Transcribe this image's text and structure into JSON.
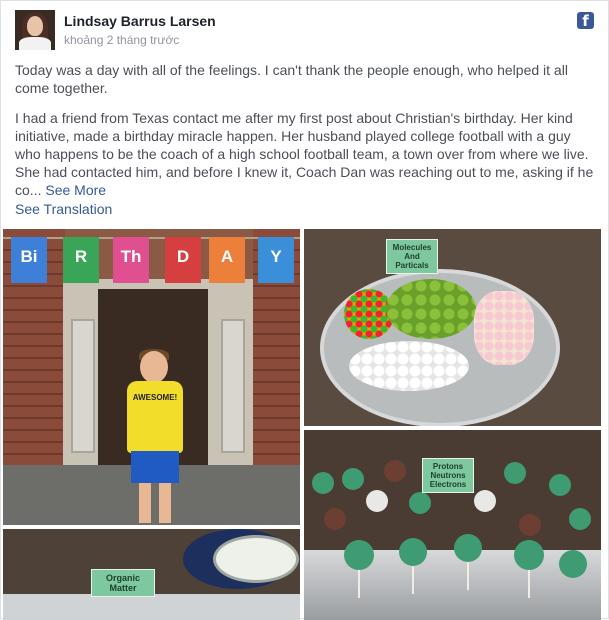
{
  "post": {
    "author": "Lindsay Barrus Larsen",
    "timestamp": "khoảng 2 tháng trước",
    "paragraph1": "Today was a day with all of the feelings. I can't thank the people enough, who helped it all come together.",
    "paragraph2": "I had a friend from Texas contact me after my first post about Christian's birthday. Her kind initiative, made a birthday miracle happen. Her husband played college football with a guy who happens to be the coach of a high school football team, a town over from where we live. She had contacted him, and before I knew it, Coach Dan was reaching out to me, asking if he co...",
    "see_more": "See More",
    "see_translation": "See Translation"
  },
  "icons": {
    "platform": "facebook-icon"
  },
  "colors": {
    "facebook_blue": "#3b5998",
    "link": "#365899",
    "muted": "#90949c"
  },
  "photos": {
    "banner_letters": [
      "Bi",
      "R",
      "Th",
      "D",
      "A",
      "Y"
    ],
    "banner_colors": [
      "#3e7fd8",
      "#3aa556",
      "#e04f8f",
      "#d63f3f",
      "#ec7f3a",
      "#3a8fd8"
    ],
    "shirt_text": "AWESOME!",
    "sign_molecules": "Molecules And Particals",
    "sign_protons": "Protons Neutrons Electrons",
    "sign_organic": "Organic Matter"
  }
}
